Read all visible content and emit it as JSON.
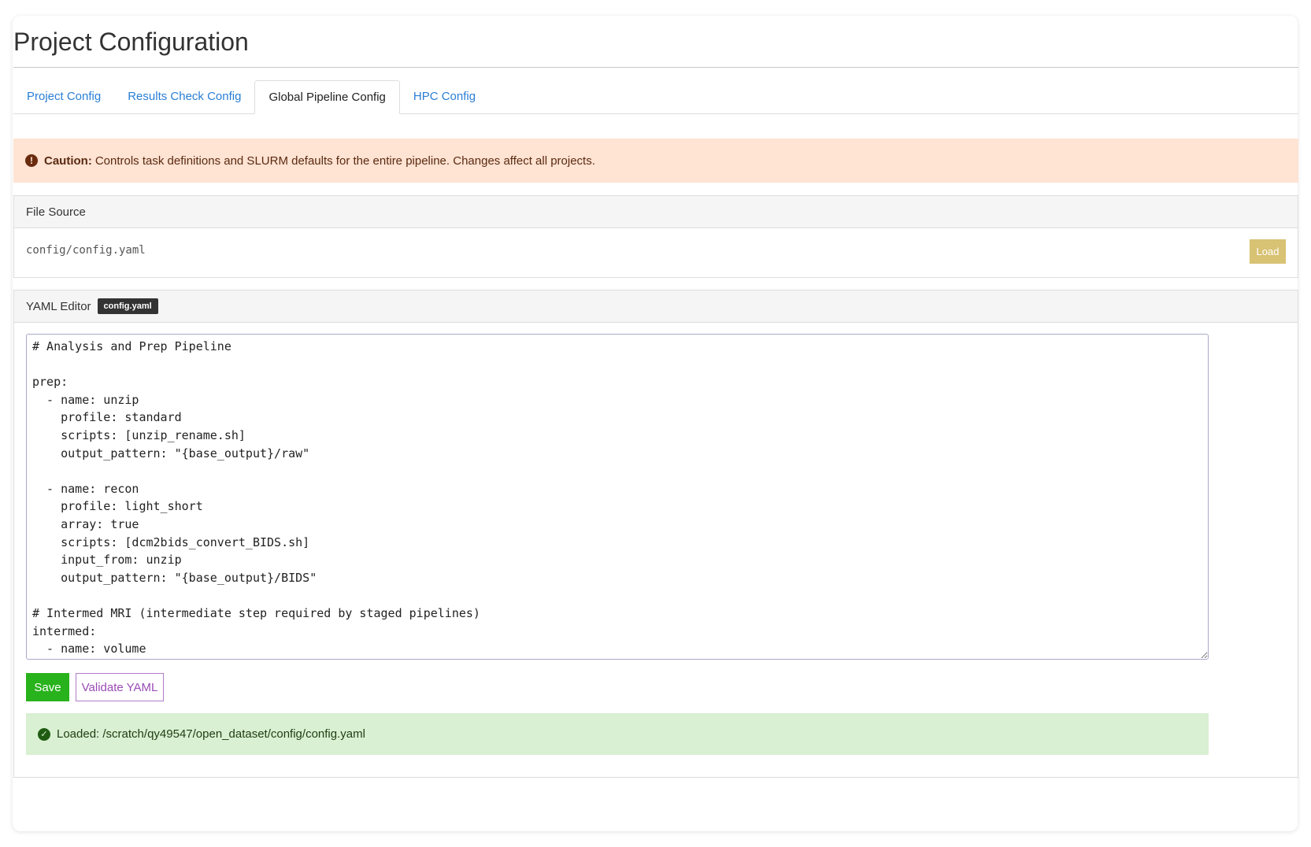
{
  "page": {
    "title": "Project Configuration"
  },
  "tabs": [
    {
      "label": "Project Config",
      "active": false
    },
    {
      "label": "Results Check Config",
      "active": false
    },
    {
      "label": "Global Pipeline Config",
      "active": true
    },
    {
      "label": "HPC Config",
      "active": false
    }
  ],
  "caution": {
    "icon": "exclamation-circle-icon",
    "strong": "Caution:",
    "text": "Controls task definitions and SLURM defaults for the entire pipeline. Changes affect all projects."
  },
  "file_source": {
    "heading": "File Source",
    "path": "config/config.yaml",
    "load_label": "Load"
  },
  "yaml_editor": {
    "heading": "YAML Editor",
    "badge": "config.yaml",
    "content": "# Analysis and Prep Pipeline\n\nprep:\n  - name: unzip\n    profile: standard\n    scripts: [unzip_rename.sh]\n    output_pattern: \"{base_output}/raw\"\n\n  - name: recon\n    profile: light_short\n    array: true\n    scripts: [dcm2bids_convert_BIDS.sh]\n    input_from: unzip\n    output_pattern: \"{base_output}/BIDS\"\n\n# Intermed MRI (intermediate step required by staged pipelines)\nintermed:\n  - name: volume",
    "save_label": "Save",
    "validate_label": "Validate YAML"
  },
  "status": {
    "icon": "check-circle-icon",
    "text": "Loaded: /scratch/qy49547/open_dataset/config/config.yaml"
  },
  "colors": {
    "link": "#2a7fd4",
    "caution_bg": "#ffe3d3",
    "success_bg": "#d9f0d2",
    "save_button": "#28b21c",
    "load_button": "#d8c274",
    "validate_button": "#9a4bb6"
  }
}
